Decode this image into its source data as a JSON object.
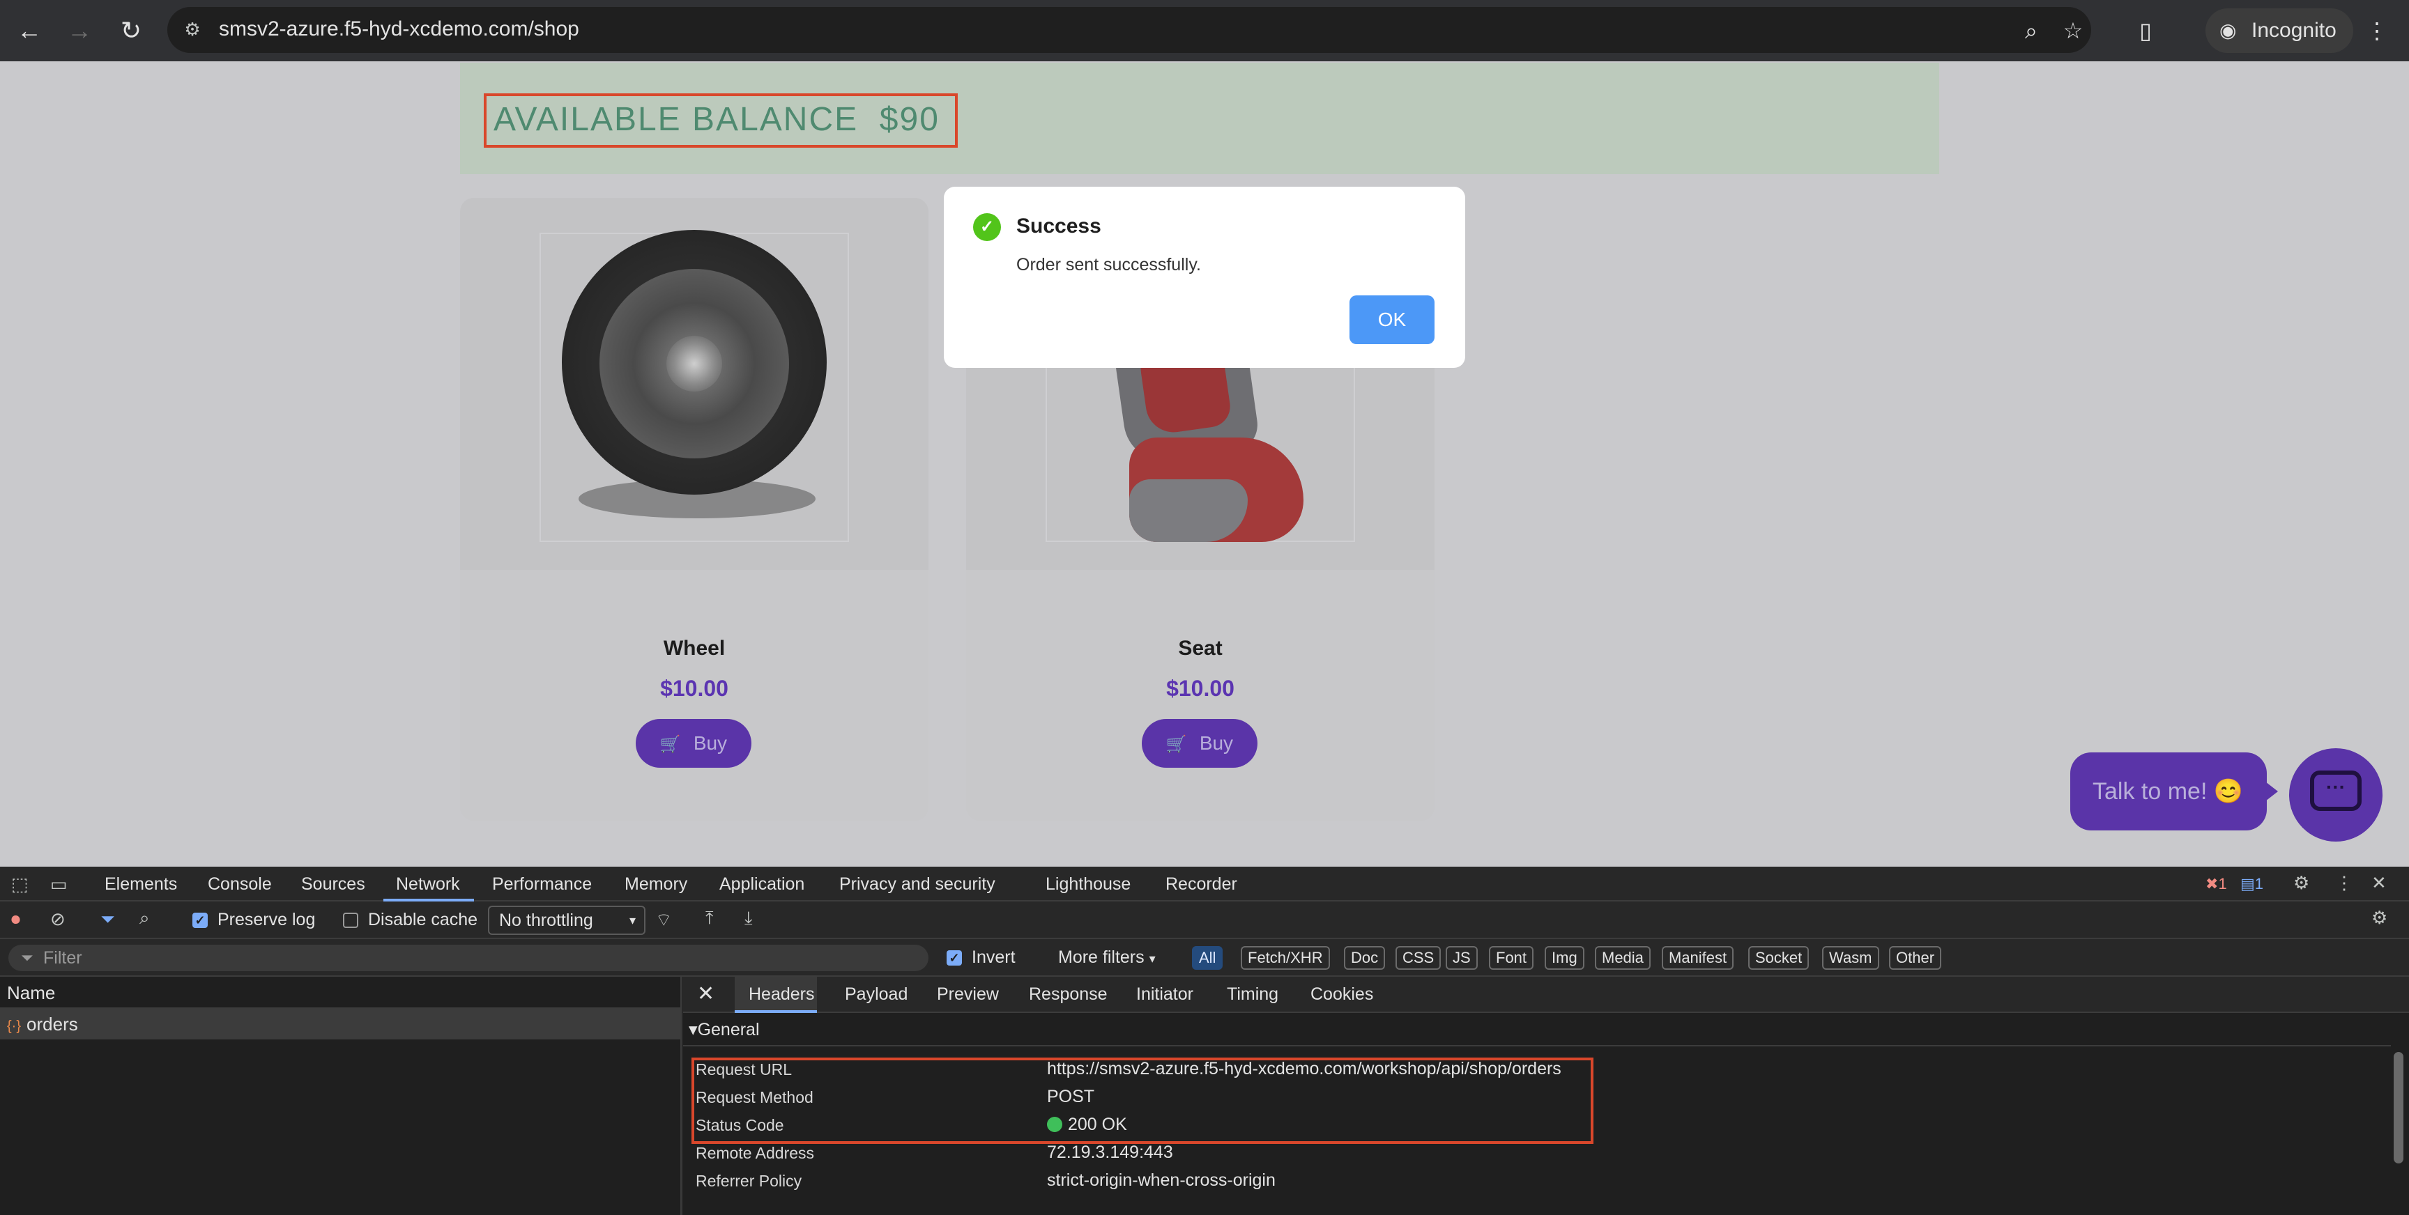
{
  "browser": {
    "url": "smsv2-azure.f5-hyd-xcdemo.com/shop",
    "incognito_label": "Incognito"
  },
  "page": {
    "balance_label": "AVAILABLE BALANCE",
    "balance_value": "$90",
    "products": [
      {
        "name": "Wheel",
        "price": "$10.00",
        "buy_label": "Buy"
      },
      {
        "name": "Seat",
        "price": "$10.00",
        "buy_label": "Buy"
      }
    ],
    "chat": {
      "bubble_text": "Talk to me! 😊"
    }
  },
  "dialog": {
    "title": "Success",
    "message": "Order sent successfully.",
    "ok_label": "OK"
  },
  "devtools": {
    "tabs": [
      "Elements",
      "Console",
      "Sources",
      "Network",
      "Performance",
      "Memory",
      "Application",
      "Privacy and security",
      "Lighthouse",
      "Recorder"
    ],
    "active_tab": "Network",
    "error_count": "1",
    "message_count": "1",
    "toolbar": {
      "preserve_log": "Preserve log",
      "disable_cache": "Disable cache",
      "throttling": "No throttling"
    },
    "filter": {
      "placeholder": "Filter",
      "invert": "Invert",
      "more_filters": "More filters",
      "types": [
        "All",
        "Fetch/XHR",
        "Doc",
        "CSS",
        "JS",
        "Font",
        "Img",
        "Media",
        "Manifest",
        "Socket",
        "Wasm",
        "Other"
      ]
    },
    "requests": {
      "name_header": "Name",
      "rows": [
        "orders"
      ]
    },
    "detail": {
      "tabs": [
        "Headers",
        "Payload",
        "Preview",
        "Response",
        "Initiator",
        "Timing",
        "Cookies"
      ],
      "section": "General",
      "headers": [
        {
          "key": "Request URL",
          "value": "https://smsv2-azure.f5-hyd-xcdemo.com/workshop/api/shop/orders"
        },
        {
          "key": "Request Method",
          "value": "POST"
        },
        {
          "key": "Status Code",
          "value": "200 OK"
        },
        {
          "key": "Remote Address",
          "value": "72.19.3.149:443"
        },
        {
          "key": "Referrer Policy",
          "value": "strict-origin-when-cross-origin"
        }
      ]
    }
  },
  "colors": {
    "accent_purple": "#5a34a8",
    "highlight_red": "#d9472b",
    "success_green": "#52c41a",
    "ok_blue": "#4c98f7"
  }
}
